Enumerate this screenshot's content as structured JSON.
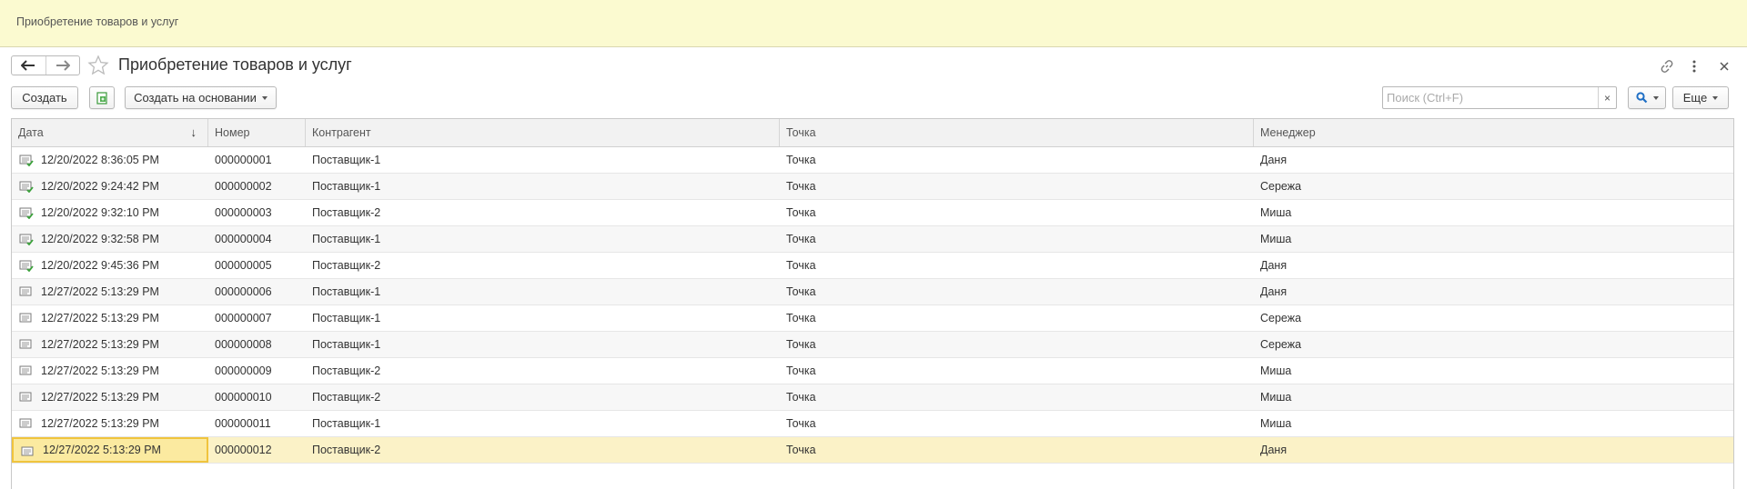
{
  "app": {
    "tab_title": "Приобретение товаров и услуг"
  },
  "header": {
    "title": "Приобретение товаров и услуг",
    "icons": [
      "back-arrow-icon",
      "forward-arrow-icon",
      "star-icon",
      "link-icon",
      "more-vertical-icon",
      "close-icon"
    ]
  },
  "toolbar": {
    "create_label": "Создать",
    "create_based_label": "Создать на основании",
    "search_placeholder": "Поиск (Ctrl+F)",
    "search_clear": "×",
    "more_label": "Еще"
  },
  "table": {
    "columns": [
      "Дата",
      "Номер",
      "Контрагент",
      "Точка",
      "Менеджер"
    ],
    "sort_indicator": "↓",
    "rows": [
      {
        "icon": "posted-doc-icon",
        "date": "12/20/2022 8:36:05 PM",
        "number": "000000001",
        "counterparty": "Поставщик-1",
        "point": "Точка",
        "manager": "Даня"
      },
      {
        "icon": "posted-doc-icon",
        "date": "12/20/2022 9:24:42 PM",
        "number": "000000002",
        "counterparty": "Поставщик-1",
        "point": "Точка",
        "manager": "Сережа"
      },
      {
        "icon": "posted-doc-icon",
        "date": "12/20/2022 9:32:10 PM",
        "number": "000000003",
        "counterparty": "Поставщик-2",
        "point": "Точка",
        "manager": "Миша"
      },
      {
        "icon": "posted-doc-icon",
        "date": "12/20/2022 9:32:58 PM",
        "number": "000000004",
        "counterparty": "Поставщик-1",
        "point": "Точка",
        "manager": "Миша"
      },
      {
        "icon": "posted-doc-icon",
        "date": "12/20/2022 9:45:36 PM",
        "number": "000000005",
        "counterparty": "Поставщик-2",
        "point": "Точка",
        "manager": "Даня"
      },
      {
        "icon": "doc-icon",
        "date": "12/27/2022 5:13:29 PM",
        "number": "000000006",
        "counterparty": "Поставщик-1",
        "point": "Точка",
        "manager": "Даня"
      },
      {
        "icon": "doc-icon",
        "date": "12/27/2022 5:13:29 PM",
        "number": "000000007",
        "counterparty": "Поставщик-1",
        "point": "Точка",
        "manager": "Сережа"
      },
      {
        "icon": "doc-icon",
        "date": "12/27/2022 5:13:29 PM",
        "number": "000000008",
        "counterparty": "Поставщик-1",
        "point": "Точка",
        "manager": "Сережа"
      },
      {
        "icon": "doc-icon",
        "date": "12/27/2022 5:13:29 PM",
        "number": "000000009",
        "counterparty": "Поставщик-2",
        "point": "Точка",
        "manager": "Миша"
      },
      {
        "icon": "doc-icon",
        "date": "12/27/2022 5:13:29 PM",
        "number": "000000010",
        "counterparty": "Поставщик-2",
        "point": "Точка",
        "manager": "Миша"
      },
      {
        "icon": "doc-icon",
        "date": "12/27/2022 5:13:29 PM",
        "number": "000000011",
        "counterparty": "Поставщик-1",
        "point": "Точка",
        "manager": "Миша"
      },
      {
        "icon": "doc-icon",
        "date": "12/27/2022 5:13:29 PM",
        "number": "000000012",
        "counterparty": "Поставщик-2",
        "point": "Точка",
        "manager": "Даня",
        "selected": true
      }
    ]
  },
  "colors": {
    "topbar_bg": "#fbfad0",
    "selected_row_bg": "#fbf2c7",
    "selected_cell_border": "#f0c43d",
    "search_accent": "#1f6fc5",
    "posted_mark": "#3aa23a"
  }
}
